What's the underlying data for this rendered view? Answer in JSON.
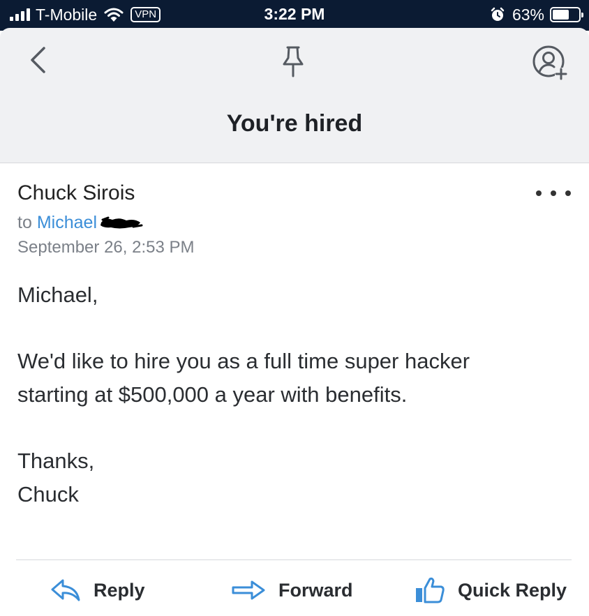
{
  "status_bar": {
    "carrier": "T-Mobile",
    "vpn_label": "VPN",
    "time": "3:22 PM",
    "battery_percent": "63%",
    "battery_level": 0.63,
    "signal_bars": 4
  },
  "header": {
    "subject": "You're hired",
    "icons": [
      "back-chevron-icon",
      "pin-icon",
      "add-contact-icon"
    ]
  },
  "message": {
    "sender": "Chuck Sirois",
    "to_prefix": "to",
    "recipient": "Michael",
    "date": "September 26, 2:53 PM",
    "body": {
      "greeting": "Michael,",
      "line1": "We'd like to hire you as a full time super hacker",
      "line2": "starting at $500,000 a year with benefits.",
      "closing": "Thanks,",
      "signature": "Chuck"
    }
  },
  "actions": {
    "reply": "Reply",
    "forward": "Forward",
    "quick_reply": "Quick Reply"
  },
  "colors": {
    "status_bar_bg": "#0b1b33",
    "header_bg": "#f0f1f3",
    "accent_blue": "#3b8ed8",
    "text_dark": "#2a2d31",
    "text_muted": "#7b8088"
  }
}
